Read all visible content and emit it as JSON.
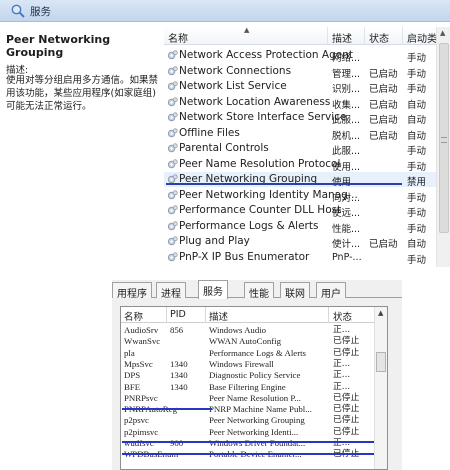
{
  "services": {
    "title": "服务",
    "selected_name": "Peer Networking Grouping",
    "description_label": "描述:",
    "description_text": "使用对等分组启用多方通信。如果禁用该功能，某些应用程序(如家庭组)可能无法正常运行。",
    "columns": [
      "名称",
      "描述",
      "状态",
      "启动类"
    ],
    "rows": [
      {
        "name": "Network Access Protection Agent",
        "desc": "网络...",
        "status": "",
        "startup": "手动"
      },
      {
        "name": "Network Connections",
        "desc": "管理...",
        "status": "已启动",
        "startup": "手动"
      },
      {
        "name": "Network List Service",
        "desc": "识别...",
        "status": "已启动",
        "startup": "手动"
      },
      {
        "name": "Network Location Awareness",
        "desc": "收集...",
        "status": "已启动",
        "startup": "自动"
      },
      {
        "name": "Network Store Interface Service",
        "desc": "此服...",
        "status": "已启动",
        "startup": "自动"
      },
      {
        "name": "Offline Files",
        "desc": "脱机...",
        "status": "已启动",
        "startup": "自动"
      },
      {
        "name": "Parental Controls",
        "desc": "此服...",
        "status": "",
        "startup": "手动"
      },
      {
        "name": "Peer Name Resolution Protocol",
        "desc": "使用...",
        "status": "",
        "startup": "手动"
      },
      {
        "name": "Peer Networking Grouping",
        "desc": "使用...",
        "status": "",
        "startup": "禁用"
      },
      {
        "name": "Peer Networking Identity Manag...",
        "desc": "向对...",
        "status": "",
        "startup": "手动"
      },
      {
        "name": "Performance Counter DLL Host",
        "desc": "使远...",
        "status": "",
        "startup": "手动"
      },
      {
        "name": "Performance Logs & Alerts",
        "desc": "性能...",
        "status": "",
        "startup": "手动"
      },
      {
        "name": "Plug and Play",
        "desc": "使计...",
        "status": "已启动",
        "startup": "自动"
      },
      {
        "name": "PnP-X IP Bus Enumerator",
        "desc": "PnP-...",
        "status": "",
        "startup": "手动"
      }
    ]
  },
  "taskmgr": {
    "tabs": [
      "用程序",
      "进程",
      "服务",
      "性能",
      "联网",
      "用户"
    ],
    "active_tab_index": 2,
    "columns": [
      "名称",
      "PID",
      "描述",
      "状态"
    ],
    "rows": [
      {
        "name": "AudioSrv",
        "pid": "856",
        "desc": "Windows Audio",
        "status": "正..."
      },
      {
        "name": "WwanSvc",
        "pid": "",
        "desc": "WWAN AutoConfig",
        "status": "已停止"
      },
      {
        "name": "pla",
        "pid": "",
        "desc": "Performance Logs & Alerts",
        "status": "已停止"
      },
      {
        "name": "MpsSvc",
        "pid": "1340",
        "desc": "Windows Firewall",
        "status": "正..."
      },
      {
        "name": "DPS",
        "pid": "1340",
        "desc": "Diagnostic Policy Service",
        "status": "正..."
      },
      {
        "name": "BFE",
        "pid": "1340",
        "desc": "Base Filtering Engine",
        "status": "正..."
      },
      {
        "name": "PNRPsvc",
        "pid": "",
        "desc": "Peer Name Resolution P...",
        "status": "已停止"
      },
      {
        "name": "PNRPAutoReg",
        "pid": "",
        "desc": "PNRP Machine Name Publ...",
        "status": "已停止"
      },
      {
        "name": "p2psvc",
        "pid": "",
        "desc": "Peer Networking Grouping",
        "status": "已停止"
      },
      {
        "name": "p2pimsvc",
        "pid": "",
        "desc": "Peer Networking Identi...",
        "status": "已停止"
      },
      {
        "name": "wudfsvc",
        "pid": "900",
        "desc": "Windows Driver Foundat...",
        "status": "正..."
      },
      {
        "name": "WPDBusEnum",
        "pid": "",
        "desc": "Portable Device Enumer...",
        "status": "已停止"
      }
    ]
  },
  "colors": {
    "highlight_line": "#2c3fb0",
    "selected_row": "#e7f1fc"
  }
}
